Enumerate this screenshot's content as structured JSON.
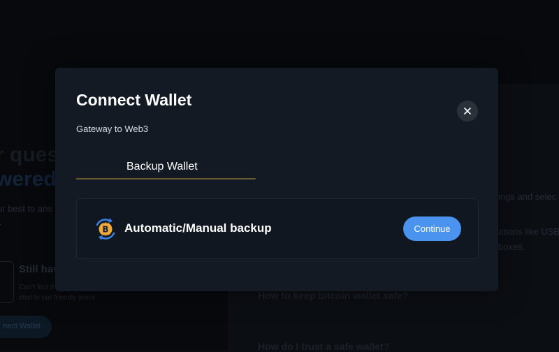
{
  "background": {
    "heading_line1": "r quest",
    "heading_line2": "wered",
    "subtext_line1": "ur best to ans",
    "subtext_line2": "-",
    "card_title": "Still hav",
    "card_sub_line1": "Can't find th",
    "card_sub_line2": "chat to our friendly team!",
    "connect_button": "nect Wallet",
    "right_text_1": "ings and selec",
    "right_text_2": "ations like USB",
    "right_text_3": "boxes.",
    "faq_1": "How to keep bitcoin wallet safe?",
    "faq_2": "How do I trust a safe wallet?"
  },
  "modal": {
    "title": "Connect Wallet",
    "subtitle": "Gateway to Web3",
    "tab_label": "Backup Wallet",
    "option": {
      "label": "Automatic/Manual backup",
      "icon": "bitcoin-icon",
      "button_label": "Continue"
    },
    "close_icon": "close-icon"
  },
  "colors": {
    "accent": "#4a93ef",
    "tab_underline": "#6b5a2e",
    "modal_bg": "#131a24",
    "bitcoin_gold": "#f2a93b",
    "icon_blue": "#3d7fe0"
  }
}
